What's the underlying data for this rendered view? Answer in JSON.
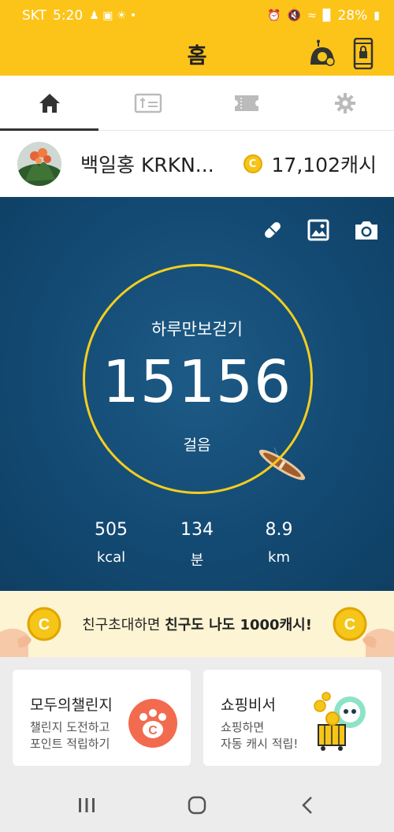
{
  "status_bar": {
    "carrier": "SKT",
    "time": "5:20",
    "battery": "28%"
  },
  "header": {
    "title": "홈"
  },
  "tabs": [
    {
      "name": "home",
      "active": true
    },
    {
      "name": "receipt",
      "active": false
    },
    {
      "name": "ticket",
      "active": false
    },
    {
      "name": "settings",
      "active": false
    }
  ],
  "profile": {
    "name": "백일홍 KRKN...",
    "coin_symbol": "C",
    "cash": "17,102캐시"
  },
  "pedometer": {
    "label": "하루만보걷기",
    "steps": "15156",
    "steps_unit": "걸음",
    "stats": [
      {
        "value": "505",
        "unit": "kcal"
      },
      {
        "value": "134",
        "unit": "분"
      },
      {
        "value": "8.9",
        "unit": "km"
      }
    ]
  },
  "banner": {
    "text_prefix": "친구초대하면 ",
    "text_bold": "친구도 나도 1000캐시!"
  },
  "cards": [
    {
      "title": "모두의챌린지",
      "subtitle": "챌린지 도전하고\n포인트 적립하기"
    },
    {
      "title": "쇼핑비서",
      "subtitle": "쇼핑하면\n자동 캐시 적립!"
    }
  ],
  "colors": {
    "brand_yellow": "#fcc419",
    "hero_blue": "#134a73",
    "ring_yellow": "#f5cd1e",
    "banner_bg": "#fdf4d3",
    "challenge_orange": "#f26b4f"
  }
}
